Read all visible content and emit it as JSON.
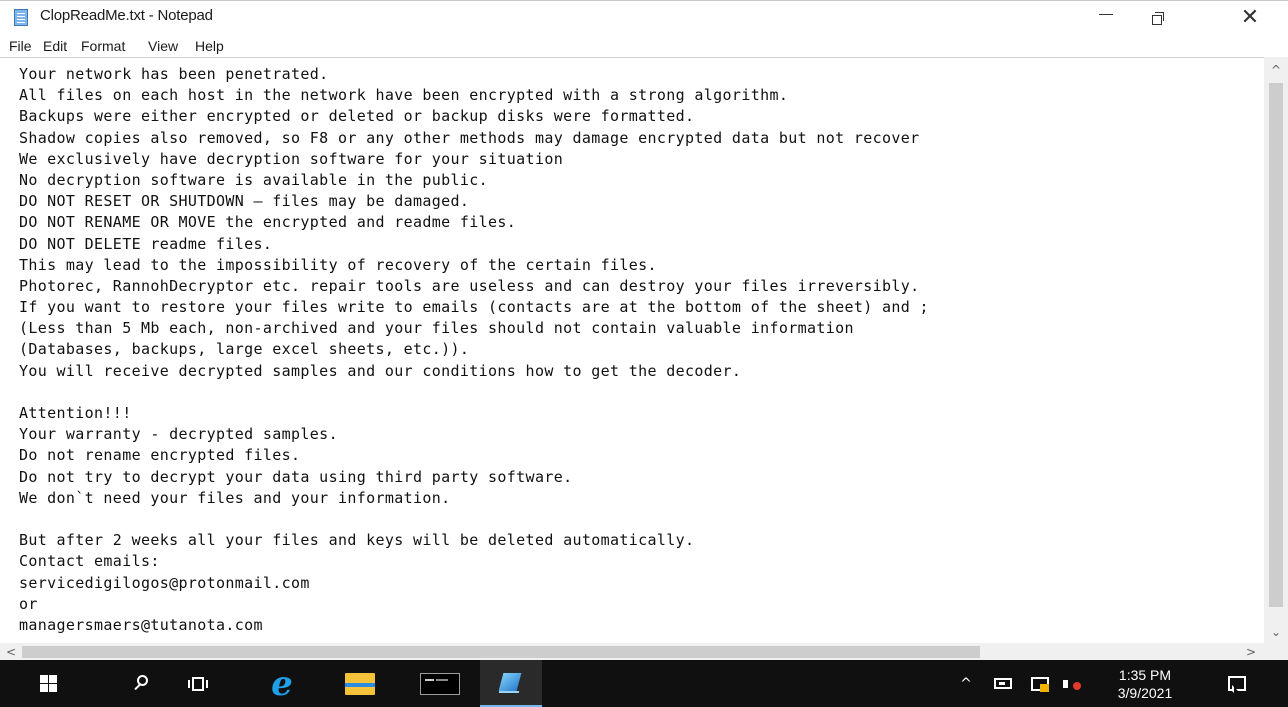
{
  "window": {
    "title": "ClopReadMe.txt - Notepad",
    "close_glyph": "✕"
  },
  "menu": {
    "file": "File",
    "edit": "Edit",
    "format": "Format",
    "view": "View",
    "help": "Help"
  },
  "document": {
    "lines": [
      "Your network has been penetrated.",
      "All files on each host in the network have been encrypted with a strong algorithm.",
      "Backups were either encrypted or deleted or backup disks were formatted.",
      "Shadow copies also removed, so F8 or any other methods may damage encrypted data but not recover",
      "We exclusively have decryption software for your situation",
      "No decryption software is available in the public.",
      "DO NOT RESET OR SHUTDOWN – files may be damaged.",
      "DO NOT RENAME OR MOVE the encrypted and readme files.",
      "DO NOT DELETE readme files.",
      "This may lead to the impossibility of recovery of the certain files.",
      "Photorec, RannohDecryptor etc. repair tools are useless and can destroy your files irreversibly.",
      "If you want to restore your files write to emails (contacts are at the bottom of the sheet) and ;",
      "(Less than 5 Mb each, non-archived and your files should not contain valuable information",
      "(Databases, backups, large excel sheets, etc.)).",
      "You will receive decrypted samples and our conditions how to get the decoder.",
      "",
      "Attention!!!",
      "Your warranty - decrypted samples.",
      "Do not rename encrypted files.",
      "Do not try to decrypt your data using third party software.",
      "We don`t need your files and your information.",
      "",
      "But after 2 weeks all your files and keys will be deleted automatically.",
      "Contact emails:",
      "servicedigilogos@protonmail.com",
      "or",
      "managersmaers@tutanota.com"
    ]
  },
  "scrollbars": {
    "up": "^",
    "down": "⌄",
    "left": "<",
    "right": ">"
  },
  "taskbar": {
    "ie_glyph": "e",
    "tray_chevron": "^",
    "clock_time": "1:35 PM",
    "clock_date": "3/9/2021"
  },
  "icons": {
    "app": "notepad-icon",
    "start": "windows-logo-icon",
    "search": "search-icon",
    "task_view": "task-view-icon",
    "ie": "internet-explorer-icon",
    "explorer": "folder-icon",
    "cmd": "command-prompt-icon",
    "notepad_task": "notepad-icon",
    "network": "network-icon",
    "action_center_flag": "flag-icon",
    "volume": "volume-muted-icon",
    "notification": "notification-icon"
  },
  "colors": {
    "taskbar_bg": "#101010",
    "active_task_accent": "#76b9ed",
    "scrollbar_bg": "#f0f0f0",
    "scroll_thumb": "#cdcdcd"
  }
}
